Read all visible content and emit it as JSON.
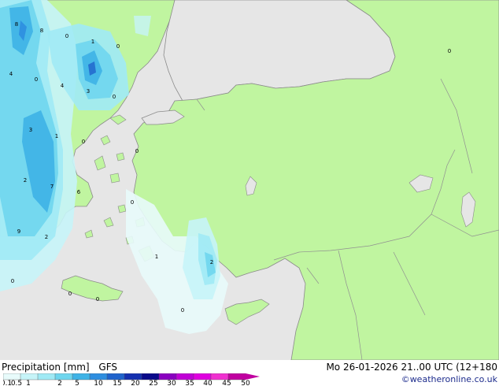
{
  "title": "Precipitation [mm]",
  "model": "GFS",
  "datetime": "Mo 26-01-2026 21..00 UTC (12+180",
  "credit": "©weatheronline.co.uk",
  "colors": {
    "sea": "#e6e6e6",
    "land": "#c0f5a0",
    "coastline": "#8a8a8a",
    "border": "#909090"
  },
  "legend": {
    "ticks": [
      "0.1",
      "0.5",
      "1",
      "2",
      "5",
      "10",
      "15",
      "20",
      "25",
      "30",
      "35",
      "40",
      "45",
      "50"
    ],
    "colors": [
      "#e8fbfb",
      "#c6f4f8",
      "#a0eaf5",
      "#6fd6ee",
      "#3eb3e6",
      "#2e8ee0",
      "#1f63cc",
      "#1430b0",
      "#0a0a8a",
      "#8a00c0",
      "#c000d6",
      "#e000e0",
      "#f030d0",
      "#c000a0"
    ]
  },
  "map_labels": [
    "8",
    "8",
    "0",
    "1",
    "0",
    "4",
    "0",
    "4",
    "3",
    "0",
    "3",
    "1",
    "0",
    "0",
    "2",
    "7",
    "6",
    "0",
    "9",
    "2",
    "1",
    "0",
    "2",
    "0",
    "0",
    "0",
    "0"
  ]
}
